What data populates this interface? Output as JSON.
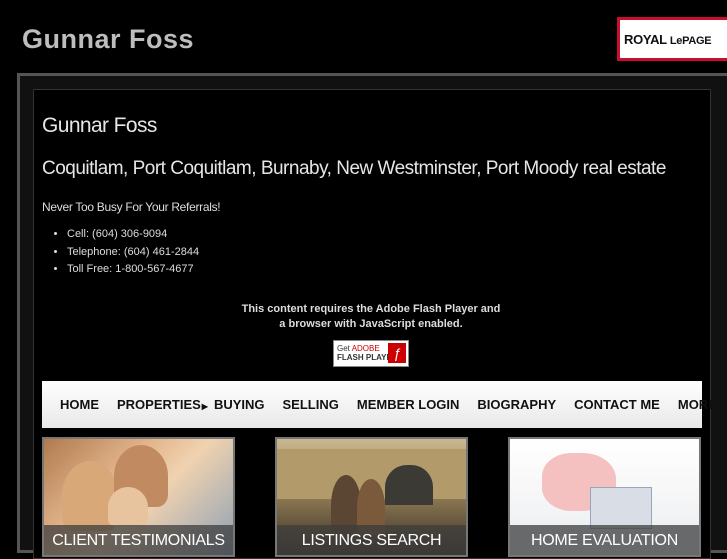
{
  "header": {
    "site_title": "Gunnar Foss",
    "logo_part1": "ROYAL ",
    "logo_part2": "LePAGE"
  },
  "main": {
    "heading": "Gunnar Foss",
    "subheading": "Coquitlam, Port Coquitlam, Burnaby, New Westminster, Port Moody real estate",
    "tagline": "Never Too Busy For Your Referrals!",
    "contacts": [
      "Cell: (604) 306-9094",
      "Telephone: (604) 461-2844",
      "Toll Free: 1-800-567-4677"
    ]
  },
  "flash": {
    "line1": "This content requires the Adobe Flash Player and",
    "line2": "a browser with JavaScript enabled.",
    "badge_get": "Get ",
    "badge_adobe": "ADOBE",
    "badge_flash": "FLASH PLAYER"
  },
  "nav": {
    "items": [
      "HOME",
      "PROPERTIES",
      "BUYING",
      "SELLING",
      "MEMBER LOGIN",
      "BIOGRAPHY",
      "CONTACT ME",
      "MORE..."
    ]
  },
  "tiles": [
    "CLIENT TESTIMONIALS",
    "LISTINGS SEARCH",
    "HOME EVALUATION"
  ],
  "colors": {
    "background": "#000000",
    "logo_red": "#c8102e",
    "nav_bg": "#f2f2f2"
  },
  "icons": [
    "flash-player-icon",
    "dropdown-arrow-icon"
  ]
}
